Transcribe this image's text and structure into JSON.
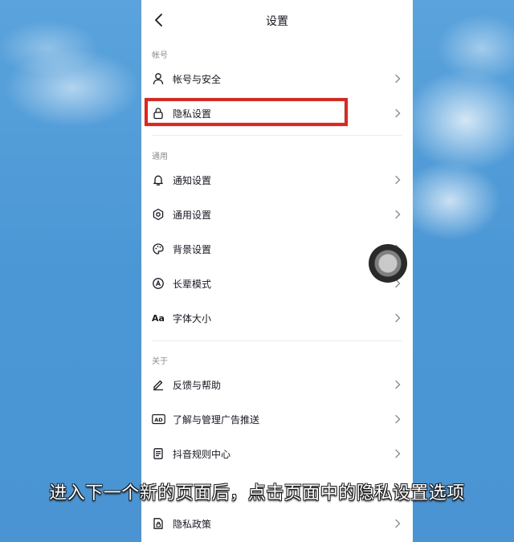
{
  "header": {
    "title": "设置"
  },
  "sections": {
    "account": {
      "label": "帐号",
      "items": [
        {
          "label": "帐号与安全",
          "icon": "person-icon"
        },
        {
          "label": "隐私设置",
          "icon": "lock-icon"
        }
      ]
    },
    "general": {
      "label": "通用",
      "items": [
        {
          "label": "通知设置",
          "icon": "bell-icon"
        },
        {
          "label": "通用设置",
          "icon": "gear-icon"
        },
        {
          "label": "背景设置",
          "icon": "palette-icon"
        },
        {
          "label": "长辈模式",
          "icon": "elder-mode-icon"
        },
        {
          "label": "字体大小",
          "icon": "font-size-icon",
          "glyph": "Aa"
        }
      ]
    },
    "about": {
      "label": "关于",
      "items": [
        {
          "label": "反馈与帮助",
          "icon": "edit-pen-icon"
        },
        {
          "label": "了解与管理广告推送",
          "icon": "ad-icon",
          "glyph": "AD"
        },
        {
          "label": "抖音规则中心",
          "icon": "rules-doc-icon"
        },
        {
          "label": "隐私政策",
          "icon": "privacy-policy-icon"
        }
      ]
    }
  },
  "caption": "进入下一个新的页面后，点击页面中的隐私设置选项",
  "colors": {
    "highlight": "#e8231b",
    "background": "#4f9ad6"
  }
}
